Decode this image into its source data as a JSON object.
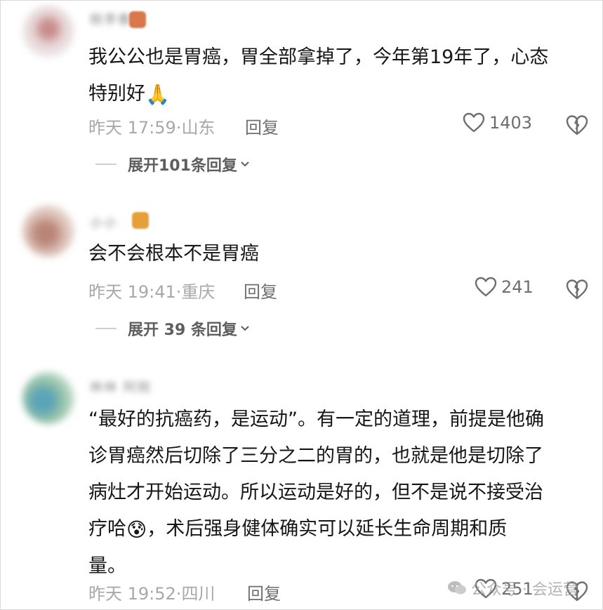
{
  "comments": [
    {
      "username": "桃李春",
      "text_lines": [
        "我公公也是胃癌，胃全部拿掉了，今年第19年了，心态",
        "特别好"
      ],
      "emoji": "🙏",
      "time": "昨天 17:59",
      "location": "山东",
      "reply_label": "回复",
      "likes": "1403",
      "expand_label": "展开101条回复"
    },
    {
      "username": "小小",
      "text_lines": [
        "会不会根本不是胃癌"
      ],
      "time": "昨天 19:41",
      "location": "重庆",
      "reply_label": "回复",
      "likes": "241",
      "expand_label": "展开 39 条回复"
    },
    {
      "username": "林林 阿刚",
      "text_lines": [
        "“最好的抗癌药，是运动”。有一定的道理，前提是他确",
        "诊胃癌然后切除了三分之二的胃的，也就是他是切除了",
        "病灶才开始运动。所以运动是好的，但不是说不接受治",
        "疗哈",
        "量。"
      ],
      "line4_suffix": "，术后强身健体确实可以延长生命周期和质",
      "emoji": "😰",
      "time": "昨天 19:52",
      "location": "四川",
      "reply_label": "回复",
      "likes": "251"
    }
  ],
  "watermark": "公众号 · 会运营",
  "icons": {
    "like": "heart-outline-icon",
    "dislike": "broken-heart-icon",
    "expand": "chevron-down-icon",
    "watermark": "wechat-icon"
  }
}
